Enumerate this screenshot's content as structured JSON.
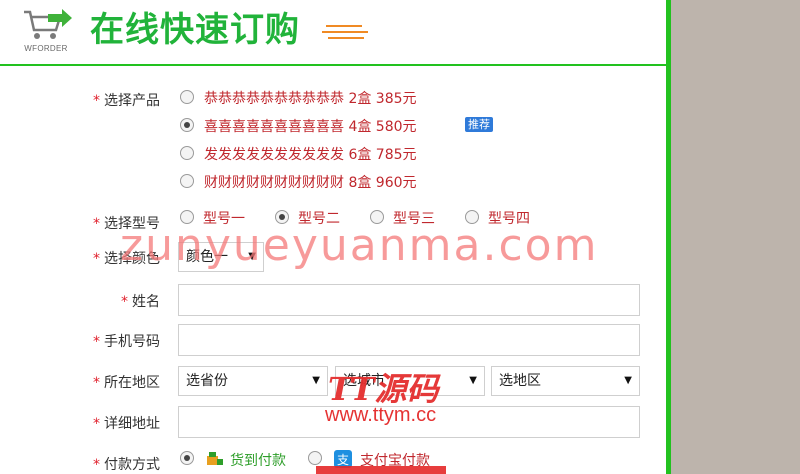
{
  "header": {
    "logo_text": "WFORDER",
    "title": "在线快速订购"
  },
  "form": {
    "required_mark": "*",
    "product": {
      "label": "选择产品",
      "selected_index": 1,
      "options": [
        {
          "text": "恭恭恭恭恭恭恭恭恭恭 2盒 385元",
          "badge": ""
        },
        {
          "text": "喜喜喜喜喜喜喜喜喜喜 4盒 580元",
          "badge": "推荐"
        },
        {
          "text": "发发发发发发发发发发 6盒 785元",
          "badge": ""
        },
        {
          "text": "财财财财财财财财财财 8盒 960元",
          "badge": ""
        }
      ]
    },
    "model": {
      "label": "选择型号",
      "selected_index": 1,
      "options": [
        "型号一",
        "型号二",
        "型号三",
        "型号四"
      ]
    },
    "color": {
      "label": "选择颜色",
      "value": "颜色一"
    },
    "name": {
      "label": "姓名",
      "value": ""
    },
    "phone": {
      "label": "手机号码",
      "value": ""
    },
    "region": {
      "label": "所在地区",
      "province": "选省份",
      "city": "选城市",
      "district": "选地区"
    },
    "address": {
      "label": "详细地址",
      "value": ""
    },
    "payment": {
      "label": "付款方式",
      "selected_index": 0,
      "options": [
        {
          "text": "货到付款",
          "icon": "delivery-icon",
          "color": "#2e9e2a"
        },
        {
          "text": "支付宝付款",
          "icon": "alipay-icon",
          "color": "#c0282e"
        }
      ]
    }
  },
  "watermark": {
    "line1": "zunyueyuanma.com",
    "line2": "TT源码",
    "line3": "www.ttym.cc"
  },
  "colors": {
    "accent_green": "#22c21f",
    "title_green": "#21b33a",
    "option_red": "#c0282e",
    "badge_blue": "#2f7ad9",
    "background_gray": "#bdb4ac"
  }
}
